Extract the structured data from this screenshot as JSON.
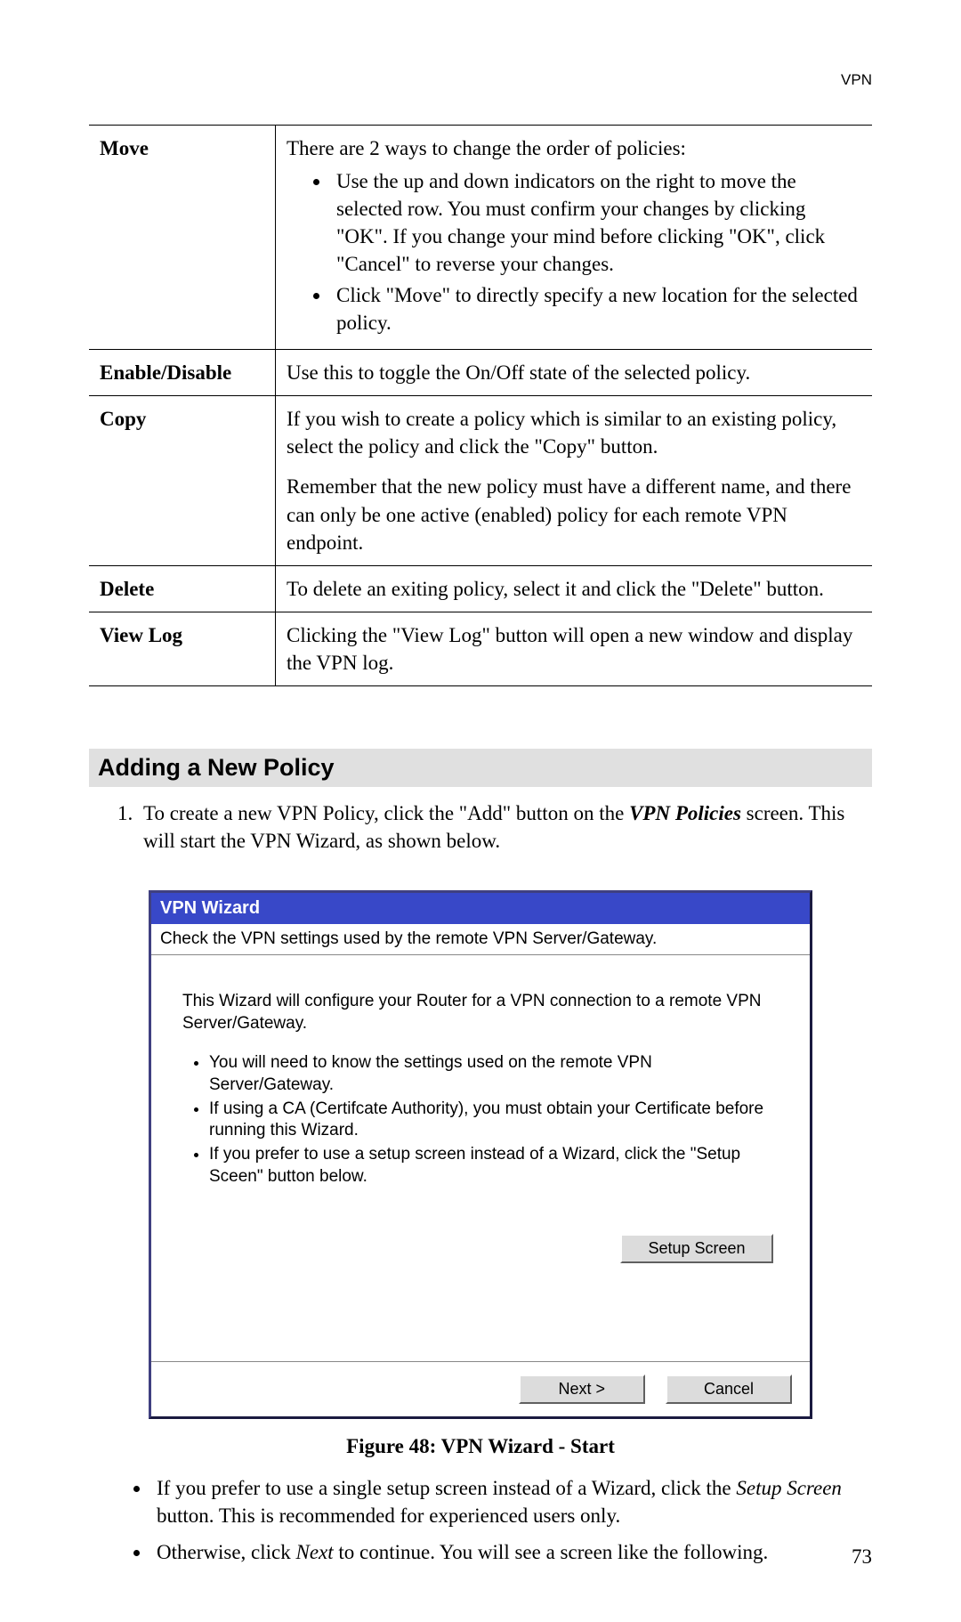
{
  "header_right": "VPN",
  "table": {
    "move": {
      "label": "Move",
      "intro": "There are 2 ways to change the order of policies:",
      "b1": "Use the up and down indicators on the right to move the selected row. You must confirm your changes by clicking \"OK\". If you change your mind before clicking \"OK\", click \"Cancel\" to reverse your changes.",
      "b2": "Click \"Move\" to directly specify a new location for the selected policy."
    },
    "enable": {
      "label": "Enable/Disable",
      "text": "Use this to toggle the On/Off state of the selected policy."
    },
    "copy": {
      "label": "Copy",
      "p1": "If you wish to create a policy which is similar to an existing policy, select the policy and click the \"Copy\" button.",
      "p2": "Remember that the new policy must have a different name, and there can only be one active (enabled) policy for each remote VPN endpoint."
    },
    "delete": {
      "label": "Delete",
      "text": "To delete an exiting policy, select it and click the \"Delete\" button."
    },
    "viewlog": {
      "label": "View Log",
      "text": "Clicking the \"View Log\" button will open a new window and display the VPN log."
    }
  },
  "section_heading": "Adding a New Policy",
  "step1": {
    "pre": "To create a new VPN Policy, click the \"Add\" button on the ",
    "em": "VPN Policies",
    "post": " screen. This will start the VPN Wizard, as shown below."
  },
  "wizard": {
    "title": "VPN Wizard",
    "subtitle": "Check the VPN settings used by the remote VPN Server/Gateway.",
    "intro": "This Wizard will configure your Router for a VPN connection to a remote VPN Server/Gateway.",
    "b1": "You will need to know the settings used on the remote VPN Server/Gateway.",
    "b2": "If using a CA (Certifcate Authority), you must obtain your Certificate before running this Wizard.",
    "b3": "If you prefer to use a setup screen instead of a Wizard, click the \"Setup Sceen\" button below.",
    "btn_setup": "Setup Screen",
    "btn_next": "Next >",
    "btn_cancel": "Cancel"
  },
  "figure_caption": "Figure 48: VPN Wizard - Start",
  "after": {
    "b1_pre": "If you prefer to use a single setup screen instead of a Wizard, click the ",
    "b1_em": "Setup Screen",
    "b1_post": " button. This is recommended for experienced users only.",
    "b2_pre": "Otherwise, click ",
    "b2_em": "Next",
    "b2_post": " to continue. You will see a screen like the following."
  },
  "page_number": "73"
}
